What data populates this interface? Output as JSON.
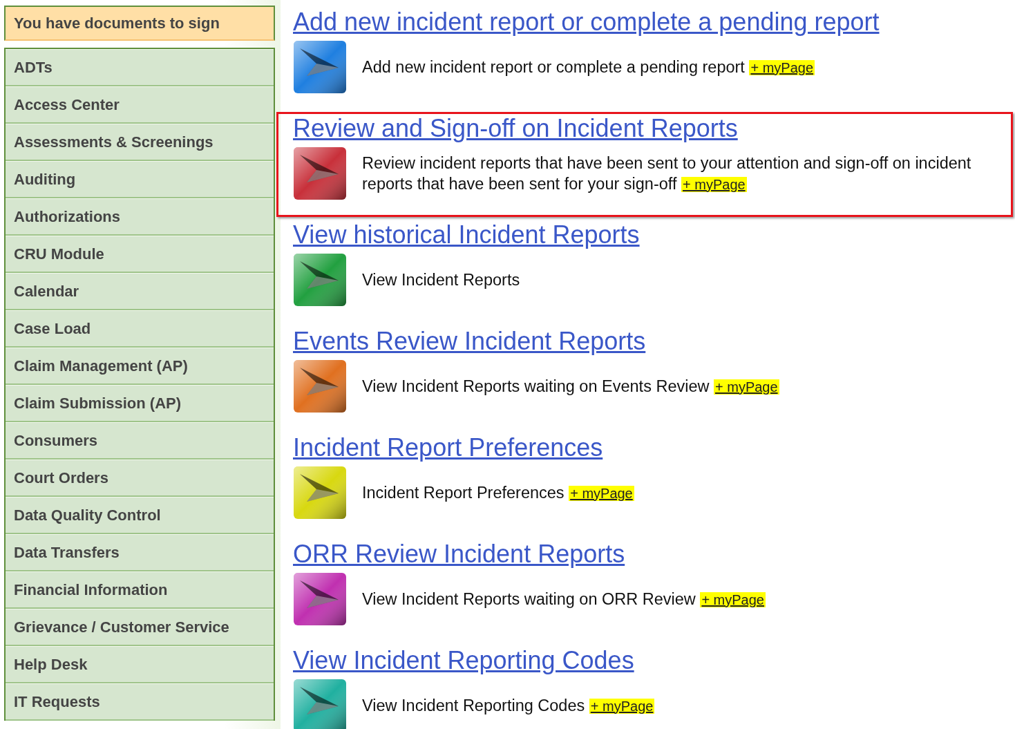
{
  "notice": "You have documents to sign",
  "sidebar": {
    "items": [
      {
        "label": "ADTs"
      },
      {
        "label": "Access Center"
      },
      {
        "label": "Assessments & Screenings"
      },
      {
        "label": "Auditing"
      },
      {
        "label": "Authorizations"
      },
      {
        "label": "CRU Module"
      },
      {
        "label": "Calendar"
      },
      {
        "label": "Case Load"
      },
      {
        "label": "Claim Management (AP)"
      },
      {
        "label": "Claim Submission (AP)"
      },
      {
        "label": "Consumers"
      },
      {
        "label": "Court Orders"
      },
      {
        "label": "Data Quality Control"
      },
      {
        "label": "Data Transfers"
      },
      {
        "label": "Financial Information"
      },
      {
        "label": "Grievance / Customer Service"
      },
      {
        "label": "Help Desk"
      },
      {
        "label": "IT Requests"
      }
    ]
  },
  "sections": [
    {
      "title": "Add new incident report or complete a pending report",
      "description": "Add new incident report or complete a pending report",
      "mypage": "+ myPage",
      "color": "#1f7fe0",
      "highlighted": false
    },
    {
      "title": "Review and Sign-off on Incident Reports",
      "description": "Review incident reports that have been sent to your attention and sign-off on incident reports that have been sent for your sign-off",
      "mypage": "+ myPage",
      "color": "#c8303a",
      "highlighted": true
    },
    {
      "title": "View historical Incident Reports",
      "description": "View Incident Reports",
      "color": "#22a040",
      "highlighted": false
    },
    {
      "title": "Events Review Incident Reports",
      "description": "View Incident Reports waiting on Events Review",
      "mypage": "+ myPage",
      "color": "#e07020",
      "highlighted": false
    },
    {
      "title": "Incident Report Preferences",
      "description": "Incident Report Preferences",
      "mypage": "+ myPage",
      "color": "#d8d810",
      "highlighted": false
    },
    {
      "title": "ORR Review Incident Reports",
      "description": "View Incident Reports waiting on ORR Review",
      "mypage": "+ myPage",
      "color": "#c030b0",
      "highlighted": false
    },
    {
      "title": "View Incident Reporting Codes",
      "description": "View Incident Reporting Codes",
      "mypage": "+ myPage",
      "color": "#20b0a0",
      "highlighted": false
    }
  ]
}
